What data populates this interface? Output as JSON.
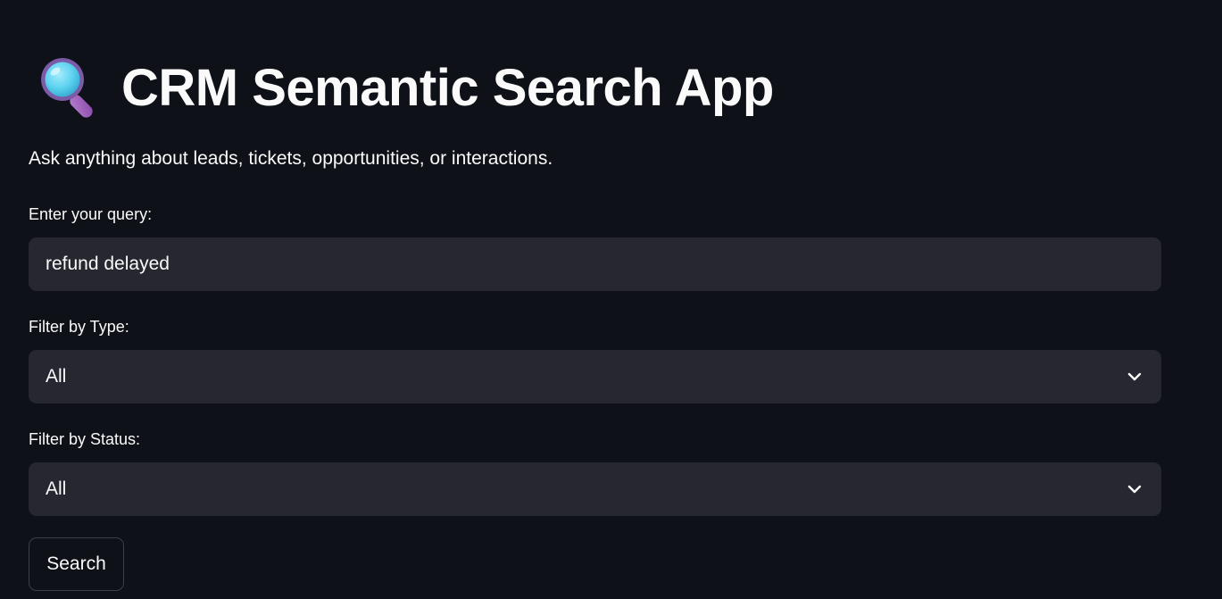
{
  "header": {
    "icon": "magnifying-glass-icon",
    "title": "CRM Semantic Search App",
    "subtitle": "Ask anything about leads, tickets, opportunities, or interactions."
  },
  "query": {
    "label": "Enter your query:",
    "value": "refund delayed"
  },
  "type_filter": {
    "label": "Filter by Type:",
    "selected": "All",
    "icon": "chevron-down-icon"
  },
  "status_filter": {
    "label": "Filter by Status:",
    "selected": "All",
    "icon": "chevron-down-icon"
  },
  "actions": {
    "search_label": "Search"
  },
  "colors": {
    "background": "#0e1117",
    "input_background": "#262730",
    "text": "#fafafa",
    "button_border": "#3d3f4a",
    "icon_lens": "#5fd3f0",
    "icon_handle": "#9b59b6"
  }
}
